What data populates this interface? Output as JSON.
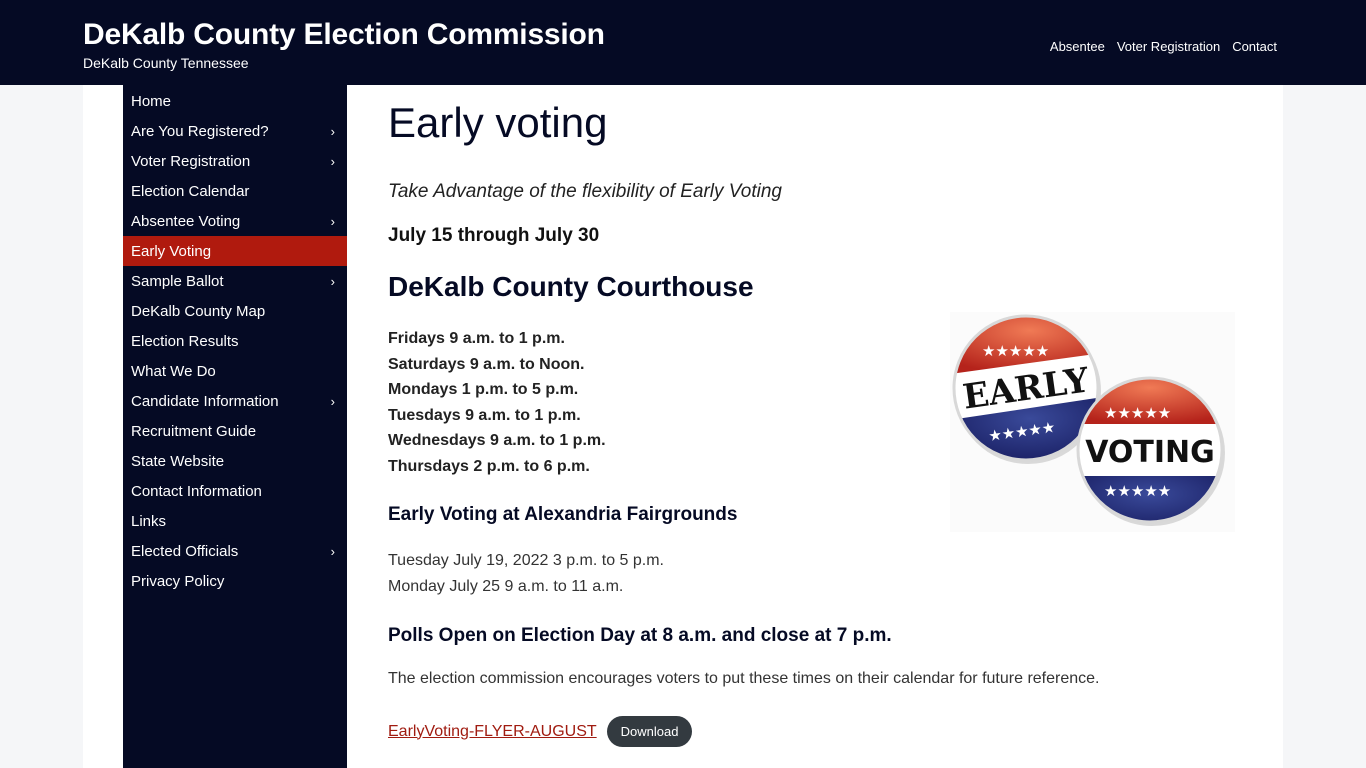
{
  "header": {
    "site_title": "DeKalb County Election Commission",
    "tagline": "DeKalb County Tennessee",
    "nav": [
      "Absentee",
      "Voter Registration",
      "Contact"
    ]
  },
  "sidebar": {
    "items": [
      {
        "label": "Home",
        "has_submenu": false,
        "active": false
      },
      {
        "label": "Are You Registered?",
        "has_submenu": true,
        "active": false
      },
      {
        "label": "Voter Registration",
        "has_submenu": true,
        "active": false
      },
      {
        "label": "Election Calendar",
        "has_submenu": false,
        "active": false
      },
      {
        "label": "Absentee Voting",
        "has_submenu": true,
        "active": false
      },
      {
        "label": "Early Voting",
        "has_submenu": false,
        "active": true
      },
      {
        "label": "Sample Ballot",
        "has_submenu": true,
        "active": false
      },
      {
        "label": "DeKalb County Map",
        "has_submenu": false,
        "active": false
      },
      {
        "label": "Election Results",
        "has_submenu": false,
        "active": false
      },
      {
        "label": "What We Do",
        "has_submenu": false,
        "active": false
      },
      {
        "label": "Candidate Information",
        "has_submenu": true,
        "active": false
      },
      {
        "label": "Recruitment Guide",
        "has_submenu": false,
        "active": false
      },
      {
        "label": "State Website",
        "has_submenu": false,
        "active": false
      },
      {
        "label": "Contact Information",
        "has_submenu": false,
        "active": false
      },
      {
        "label": "Links",
        "has_submenu": false,
        "active": false
      },
      {
        "label": "Elected Officials",
        "has_submenu": true,
        "active": false
      },
      {
        "label": "Privacy Policy",
        "has_submenu": false,
        "active": false
      }
    ],
    "chevron_glyph": "›"
  },
  "main": {
    "title": "Early voting",
    "intro": "Take Advantage of the flexibility of Early Voting",
    "date_range": "July 15 through July 30",
    "courthouse_heading": "DeKalb County Courthouse",
    "courthouse_hours": [
      "Fridays 9 a.m. to 1 p.m.",
      "Saturdays 9 a.m. to Noon.",
      "Mondays 1 p.m. to 5 p.m.",
      "Tuesdays 9 a.m. to 1 p.m.",
      "Wednesdays 9 a.m. to 1 p.m.",
      "Thursdays 2 p.m. to 6 p.m."
    ],
    "fairgrounds_heading": "Early Voting at Alexandria Fairgrounds",
    "fairgrounds_dates": [
      "Tuesday July 19, 2022 3 p.m. to 5 p.m.",
      "Monday July 25 9 a.m. to 11 a.m."
    ],
    "polls_heading": "Polls Open on Election Day at 8 a.m. and close at 7 p.m.",
    "note": "The election commission encourages voters to put these times on their calendar for future reference.",
    "file_link": "EarlyVoting-FLYER-AUGUST",
    "download_label": "Download",
    "image": {
      "badge1_text": "EARLY",
      "badge2_text": "VOTING"
    }
  },
  "colors": {
    "header_bg": "#050a24",
    "active_item": "#b01a0e",
    "link": "#a01b10",
    "button_bg": "#333a40"
  }
}
